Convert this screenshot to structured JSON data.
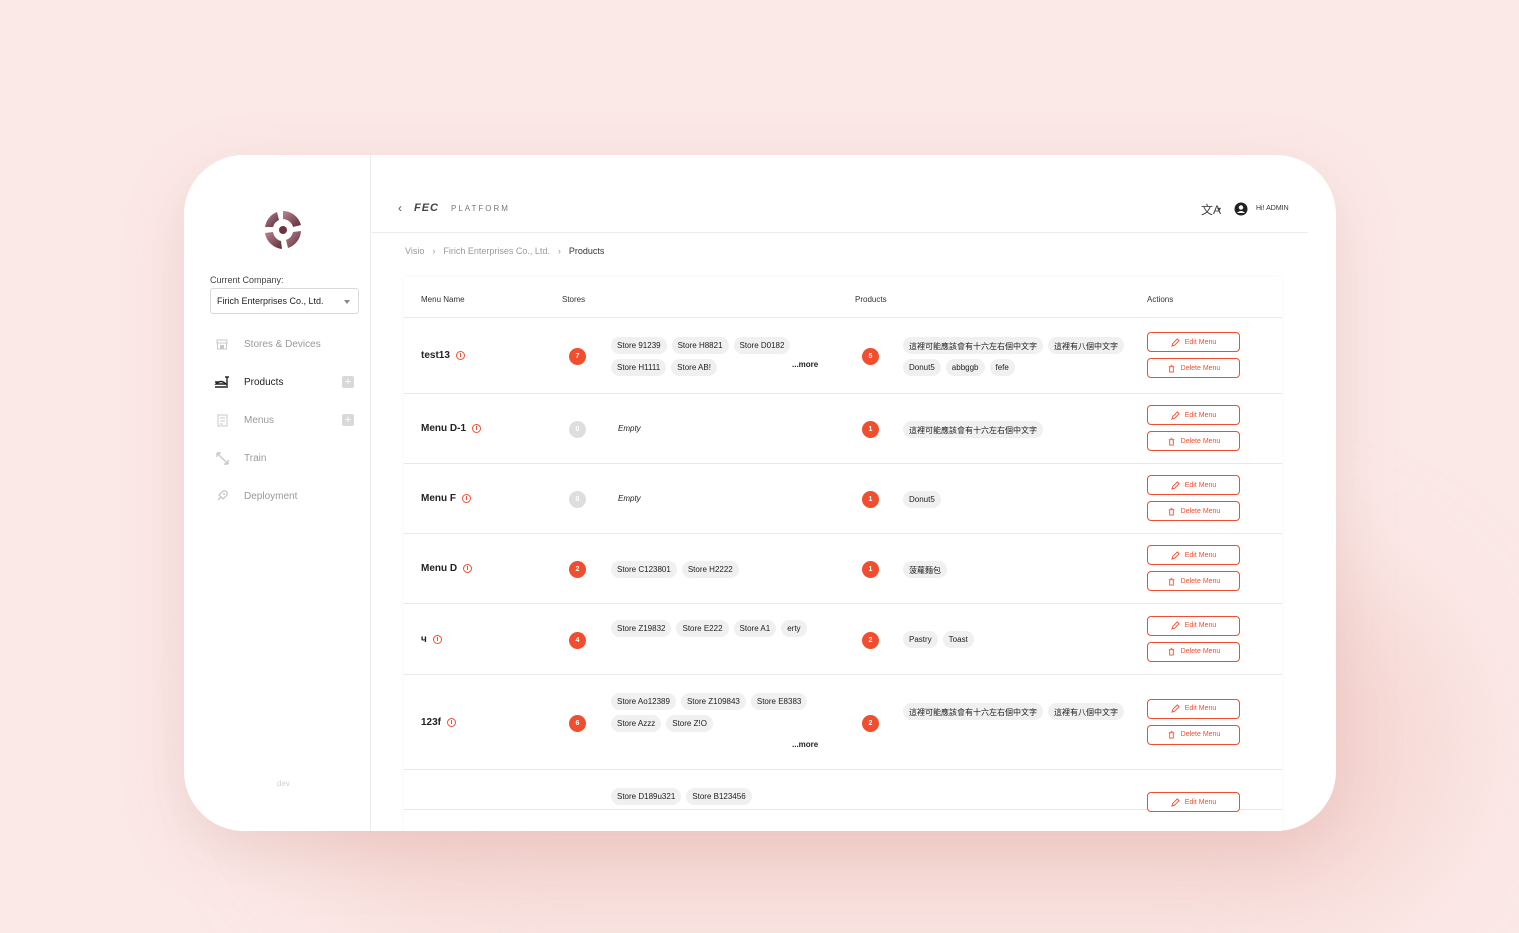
{
  "sidebar": {
    "company_label": "Current Company:",
    "company_value": "Firich Enterprises Co., Ltd.",
    "items": [
      {
        "label": "Stores & Devices",
        "icon": "store-icon"
      },
      {
        "label": "Products",
        "icon": "products-icon"
      },
      {
        "label": "Menus",
        "icon": "menus-icon"
      },
      {
        "label": "Train",
        "icon": "train-icon"
      },
      {
        "label": "Deployment",
        "icon": "deployment-icon"
      }
    ],
    "footer": "dev"
  },
  "topbar": {
    "back": "‹",
    "brand": "FEC",
    "platform": "PLATFORM",
    "lang_glyph": "文A",
    "lang_caret": "▾",
    "greeting": "Hi! ADMIN"
  },
  "breadcrumb": {
    "items": [
      "Visio",
      "Firich Enterprises Co., Ltd.",
      "Products"
    ],
    "separator": "›"
  },
  "table": {
    "headers": {
      "menu_name": "Menu Name",
      "stores": "Stores",
      "products": "Products",
      "actions": "Actions"
    },
    "edit_label": "Edit Menu",
    "delete_label": "Delete Menu",
    "more_label": "...more",
    "empty_label": "Empty",
    "rows": [
      {
        "name": "test13",
        "store_count": "7",
        "stores": [
          "Store 91239",
          "Store H8821",
          "Store D0182",
          "Store H1111",
          "Store AB!"
        ],
        "more": true,
        "product_count": "5",
        "products": [
          "這裡可能應該會有十六左右個中文字",
          "這裡有八個中文字",
          "Donut5",
          "abbggb",
          "fefe"
        ]
      },
      {
        "name": "Menu D-1",
        "store_count": "0",
        "stores": [],
        "more": false,
        "product_count": "1",
        "products": [
          "這裡可能應該會有十六左右個中文字"
        ]
      },
      {
        "name": "Menu F",
        "store_count": "0",
        "stores": [],
        "more": false,
        "product_count": "1",
        "products": [
          "Donut5"
        ]
      },
      {
        "name": "Menu D",
        "store_count": "2",
        "stores": [
          "Store C123801",
          "Store H2222"
        ],
        "more": false,
        "product_count": "1",
        "products": [
          "菠蘿麵包"
        ]
      },
      {
        "name": "ч",
        "store_count": "4",
        "stores": [
          "Store Z19832",
          "Store E222",
          "Store A1",
          "erty"
        ],
        "more": false,
        "product_count": "2",
        "products": [
          "Pastry",
          "Toast"
        ]
      },
      {
        "name": "123f",
        "store_count": "6",
        "stores": [
          "Store Ao12389",
          "Store Z109843",
          "Store E8383",
          "Store Azzz",
          "Store Z!O"
        ],
        "more": true,
        "product_count": "2",
        "products": [
          "這裡可能應該會有十六左右個中文字",
          "這裡有八個中文字"
        ]
      },
      {
        "name": "",
        "store_count": "",
        "stores": [
          "Store D189u321",
          "Store B123456"
        ],
        "more": false,
        "product_count": "",
        "products": []
      }
    ]
  },
  "colors": {
    "accent": "#f04e2f",
    "background": "#fbe9e7"
  }
}
